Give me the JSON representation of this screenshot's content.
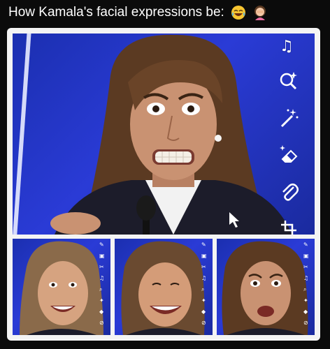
{
  "post": {
    "caption": "How Kamala's facial expressions be:",
    "emojis": [
      "face-with-tears-of-joy-icon",
      "woman-facepalming-icon"
    ]
  },
  "colors": {
    "background": "#0b0b0b",
    "card": "#f4f4f4",
    "stage_blue": "#2a3bd6",
    "hair": "#5b3a22",
    "skin": "#c99272",
    "jacket": "#1c1c2a"
  },
  "snap_tools": {
    "main": [
      "music-note-icon",
      "search-sparkle-icon",
      "magic-wand-icon",
      "eraser-icon",
      "paperclip-icon",
      "crop-icon"
    ],
    "small": [
      "pencil-icon",
      "sticker-icon",
      "scissors-icon",
      "music-note-icon",
      "search-icon",
      "magic-wand-icon",
      "eraser-icon",
      "paperclip-icon"
    ]
  }
}
